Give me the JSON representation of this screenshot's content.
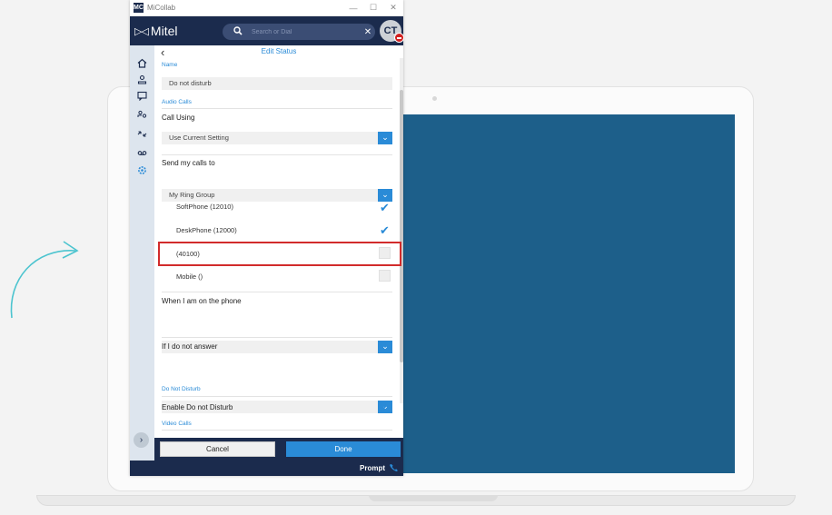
{
  "window": {
    "title": "MiCollab",
    "logo": "MC",
    "minimize": "—",
    "maximize": "☐",
    "close": "✕"
  },
  "header": {
    "brand": "Mitel",
    "brand_mark": "▷◁",
    "search_placeholder": "Search or Dial",
    "avatar_initials": "CT"
  },
  "nav": {
    "icons": [
      "home-icon",
      "contacts-icon",
      "chat-icon",
      "people-icon",
      "call-history-icon",
      "voicemail-icon",
      "settings-icon"
    ],
    "active": "settings-icon"
  },
  "panel": {
    "title": "Edit Status",
    "name_label": "Name",
    "name_value": "Do not disturb",
    "audio_calls_label": "Audio Calls",
    "call_using_label": "Call Using",
    "call_using_value": "Use Current Setting",
    "send_calls_label": "Send my calls to",
    "send_calls_value": "My Ring Group",
    "options": [
      {
        "label": "SoftPhone (12010)",
        "checked": true
      },
      {
        "label": "DeskPhone (12000)",
        "checked": true
      },
      {
        "label": "(40100)",
        "checked": false
      },
      {
        "label": "Mobile ()",
        "checked": false
      }
    ],
    "on_phone_label": "When I am on the phone",
    "on_phone_value": "",
    "no_answer_label": "If I do not answer",
    "no_answer_value": "",
    "dnd_section_label": "Do Not Disturb",
    "dnd_label": "Enable Do not Disturb",
    "dnd_checked": true,
    "video_calls_label": "Video Calls"
  },
  "footer": {
    "cancel_label": "Cancel",
    "done_label": "Done",
    "prompt_label": "Prompt"
  },
  "colors": {
    "navy": "#1b2b4d",
    "accent": "#2a8bd7",
    "highlight": "#d22b2b",
    "screen": "#1d5f8a"
  }
}
